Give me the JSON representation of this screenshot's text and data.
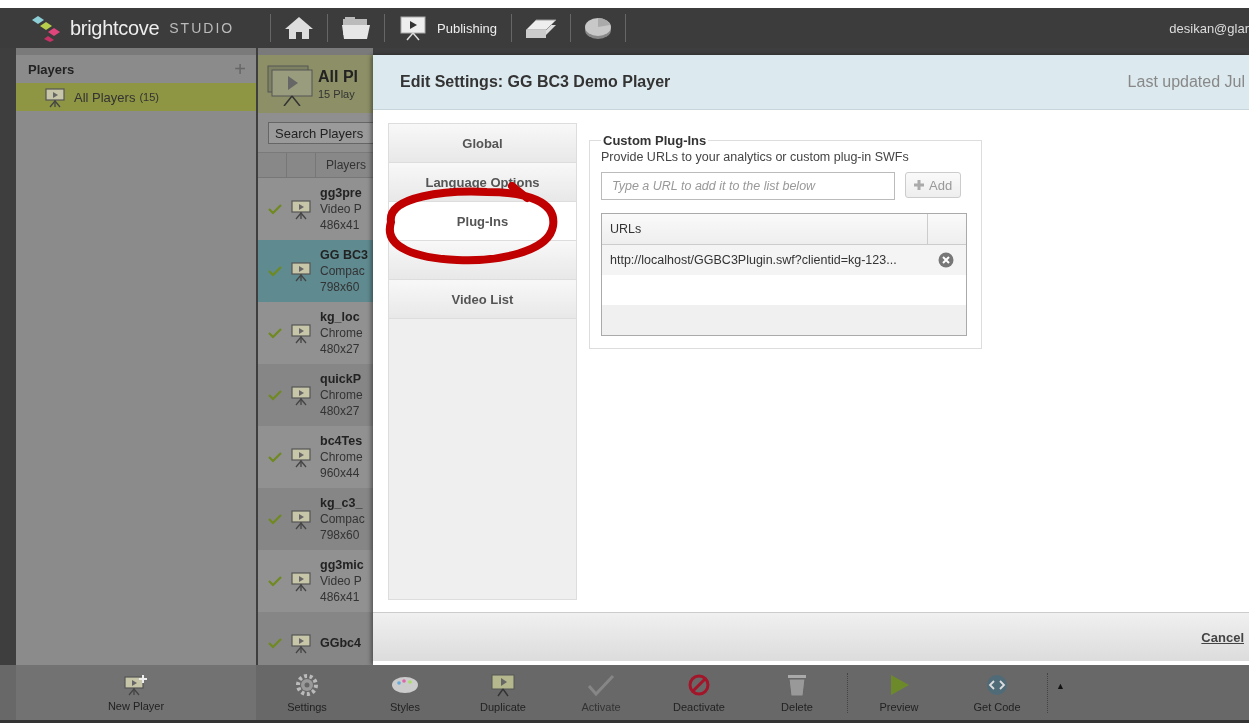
{
  "app": {
    "brand": "brightcove",
    "product": "STUDIO",
    "nav": [
      {
        "kind": "home"
      },
      {
        "kind": "folder"
      },
      {
        "kind": "publishing",
        "label": "Publishing"
      },
      {
        "kind": "money"
      },
      {
        "kind": "pie"
      }
    ],
    "user": "desikan@glar"
  },
  "sidebar": {
    "title": "Players",
    "add": "+",
    "items": [
      {
        "label": "All Players",
        "count": "(15)",
        "selected": true
      }
    ]
  },
  "player_list": {
    "title": "All Pl",
    "subtitle": "15 Play",
    "search": {
      "placeholder": "Search Players"
    },
    "column": "Players",
    "rows": [
      {
        "name": "gg3pre",
        "type": "Video P",
        "size": "486x41",
        "active": true,
        "selected": false
      },
      {
        "name": "GG BC3",
        "type": "Compac",
        "size": "798x60",
        "active": true,
        "selected": true
      },
      {
        "name": "kg_loc",
        "type": "Chrome",
        "size": "480x27",
        "active": true,
        "selected": false
      },
      {
        "name": "quickP",
        "type": "Chrome",
        "size": "480x27",
        "active": true,
        "selected": false
      },
      {
        "name": "bc4Tes",
        "type": "Chrome",
        "size": "960x44",
        "active": true,
        "selected": false
      },
      {
        "name": "kg_c3_",
        "type": "Compac",
        "size": "798x60",
        "active": true,
        "selected": false
      },
      {
        "name": "gg3mic",
        "type": "Video P",
        "size": "486x41",
        "active": true,
        "selected": false
      },
      {
        "name": "GGbc4",
        "active": true,
        "selected": false
      }
    ]
  },
  "dialog": {
    "title": "Edit Settings: GG BC3 Demo Player",
    "updated": "Last updated Jul",
    "tabs": [
      {
        "label": "Global",
        "selected": false,
        "circled": false
      },
      {
        "label": "Language Options",
        "selected": false,
        "circled": false
      },
      {
        "label": "Plug-Ins",
        "selected": true,
        "circled": true
      },
      {
        "selected": false,
        "circled": false
      },
      {
        "label": "Video List",
        "selected": false,
        "circled": false
      }
    ],
    "section": {
      "legend": "Custom Plug-Ins",
      "description": "Provide URLs to your analytics or custom plug-in SWFs",
      "url_field": {
        "placeholder": "Type a URL to add it to the list below"
      },
      "add_button": {
        "label": "Add",
        "disabled": true
      },
      "table": {
        "columns": [
          "URLs"
        ],
        "rows": [
          {
            "url": "http://localhost/GGBC3Plugin.swf?clientid=kg-123..."
          }
        ]
      }
    },
    "footer": {
      "cancel": "Cancel"
    }
  },
  "toolbar": {
    "new_player": "New Player",
    "buttons": [
      {
        "kind": "settings",
        "label": "Settings",
        "disabled": false
      },
      {
        "kind": "styles",
        "label": "Styles",
        "disabled": false
      },
      {
        "kind": "duplicate",
        "label": "Duplicate",
        "disabled": false
      },
      {
        "kind": "activate",
        "label": "Activate",
        "disabled": true
      },
      {
        "kind": "deactivate",
        "label": "Deactivate",
        "disabled": false
      },
      {
        "kind": "delete",
        "label": "Delete",
        "disabled": false
      },
      {
        "kind": "separator"
      },
      {
        "kind": "preview",
        "label": "Preview",
        "disabled": false
      },
      {
        "kind": "code",
        "label": "Get Code",
        "disabled": false
      },
      {
        "kind": "separator"
      },
      {
        "kind": "more",
        "label": "▲"
      }
    ]
  }
}
